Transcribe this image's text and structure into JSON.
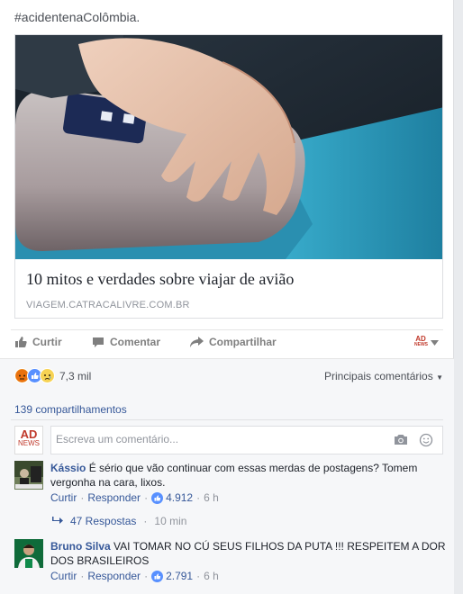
{
  "post": {
    "hashtag": "#acidentenaColômbia."
  },
  "link_preview": {
    "title": "10 mitos e verdades sobre viajar de avião",
    "domain": "VIAGEM.CATRACALIVRE.COM.BR"
  },
  "actions": {
    "like_label": "Curtir",
    "comment_label": "Comentar",
    "share_label": "Compartilhar",
    "page_avatar_text": "AD",
    "page_avatar_subtext": "NEWS"
  },
  "feedback": {
    "reaction_count": "7,3 mil",
    "sort_label": "Principais comentários",
    "shares": "139 compartilhamentos",
    "comment_placeholder": "Escreva um comentário...",
    "my_avatar_text": "AD",
    "my_avatar_subtext": "NEWS"
  },
  "comments": [
    {
      "author": "Kássio",
      "text": "É sério que vão continuar com essas merdas de postagens? Tomem vergonha na cara, lixos.",
      "like_action": "Curtir",
      "reply_action": "Responder",
      "likes": "4.912",
      "time": "6 h",
      "replies_label": "47 Respostas",
      "replies_time": "10 min"
    },
    {
      "author": "Bruno Silva",
      "text": "VAI TOMAR NO CÚ SEUS FILHOS DA PUTA !!! RESPEITEM A DOR DOS BRASILEIROS",
      "like_action": "Curtir",
      "reply_action": "Responder",
      "likes": "2.791",
      "time": "6 h"
    }
  ],
  "colors": {
    "link_blue": "#365899",
    "like_blue": "#5890ff",
    "muted": "#90949c",
    "brand_red": "#c0392b"
  }
}
